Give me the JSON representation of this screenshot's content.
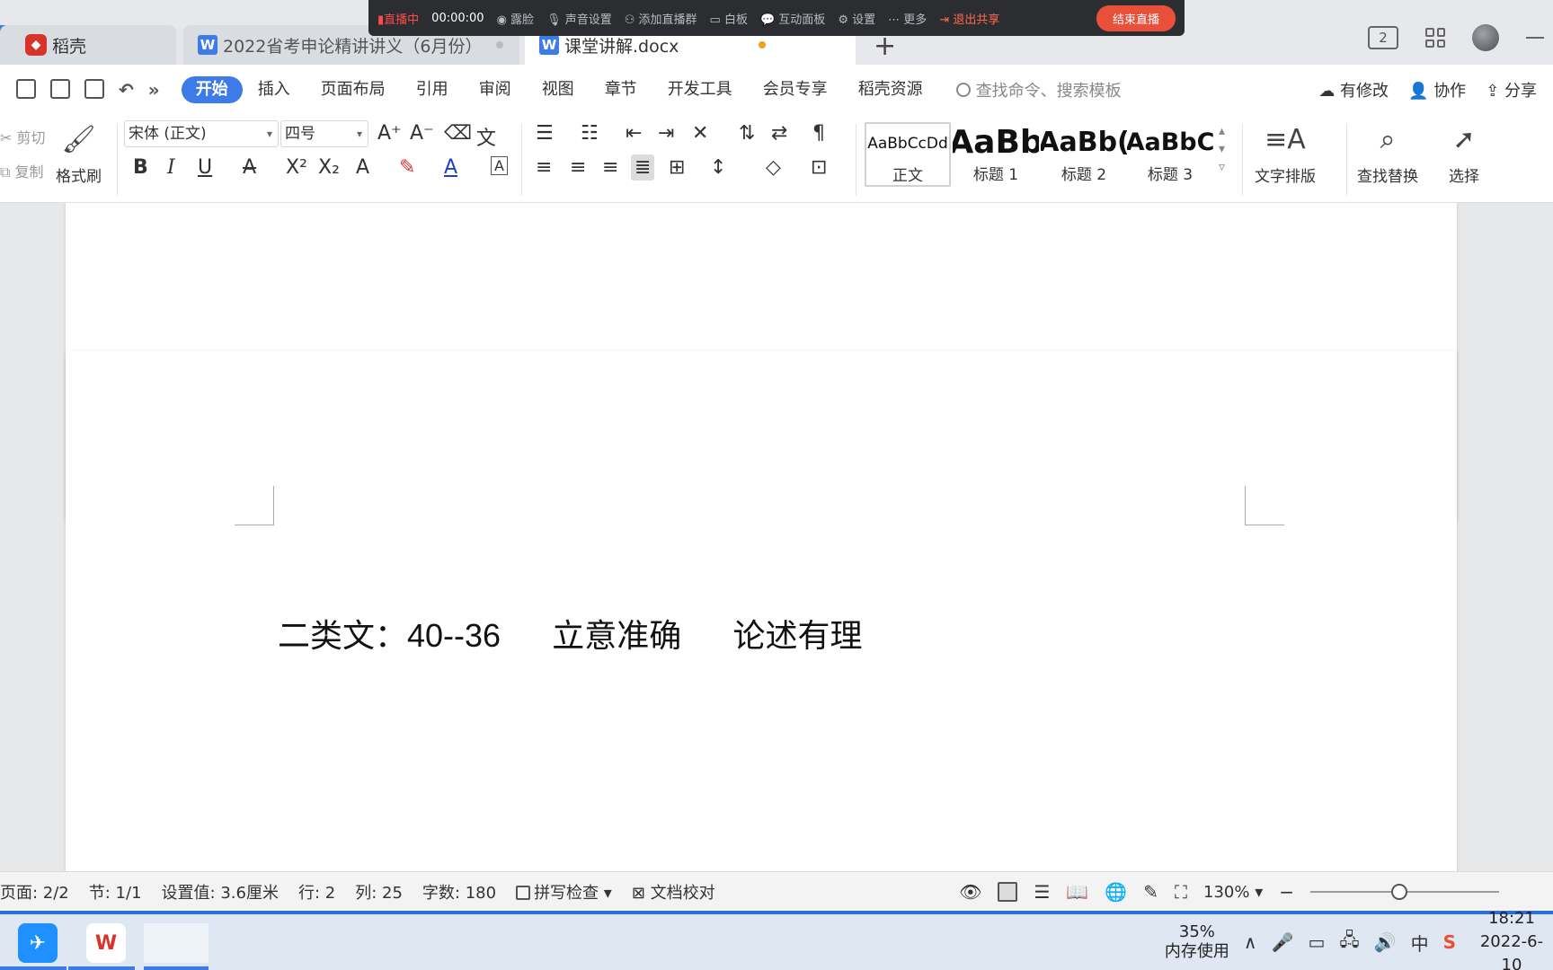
{
  "tabs": [
    {
      "label": "稻壳",
      "icon": "daoke-logo-icon"
    },
    {
      "label": "2022省考申论精讲讲义（6月份）",
      "icon": "wps-doc-icon"
    },
    {
      "label": "课堂讲解.docx",
      "icon": "wps-doc-icon"
    }
  ],
  "live": {
    "status": "直播中",
    "timer": "00:00:00",
    "items": [
      "露脸",
      "声音设置",
      "添加直播群",
      "白板",
      "互动面板",
      "设置",
      "更多"
    ],
    "exit": "退出共享",
    "end": "结束直播"
  },
  "titlebar": {
    "screen_badge": "2"
  },
  "menu": {
    "items": [
      "开始",
      "插入",
      "页面布局",
      "引用",
      "审阅",
      "视图",
      "章节",
      "开发工具",
      "会员专享",
      "稻壳资源"
    ],
    "active": "开始",
    "search_placeholder": "查找命令、搜索模板",
    "right": [
      "有修改",
      "协作",
      "分享"
    ]
  },
  "toolbar": {
    "cut": "剪切",
    "copy": "复制",
    "format_painter": "格式刷",
    "font_name": "宋体 (正文)",
    "font_size": "四号",
    "styles": [
      {
        "preview": "AaBbCcDd",
        "name": "正文"
      },
      {
        "preview": "AaBb",
        "name": "标题 1"
      },
      {
        "preview": "AaBb(",
        "name": "标题 2"
      },
      {
        "preview": "AaBbC",
        "name": "标题 3"
      }
    ],
    "text_layout": "文字排版",
    "find_replace": "查找替换",
    "select": "选择"
  },
  "document": {
    "seg1": "二类文：",
    "seg2": "40--36",
    "seg3": "立意准确",
    "seg4": "论述有理"
  },
  "status": {
    "page": "页面: 2/2",
    "section": "节: 1/1",
    "setting": "设置值: 3.6厘米",
    "row": "行: 2",
    "col": "列: 25",
    "words": "字数: 180",
    "spell": "拼写检查",
    "proof": "文档校对",
    "zoom": "130%",
    "zoom_level": 0.47
  },
  "taskbar": {
    "mem_pct": "35%",
    "mem_label": "内存使用",
    "ime": "中",
    "time": "18:21",
    "date": "2022-6-10"
  },
  "colors": {
    "accent": "#3c7be8",
    "live_red": "#e8503a",
    "wps_red": "#d6332c"
  }
}
